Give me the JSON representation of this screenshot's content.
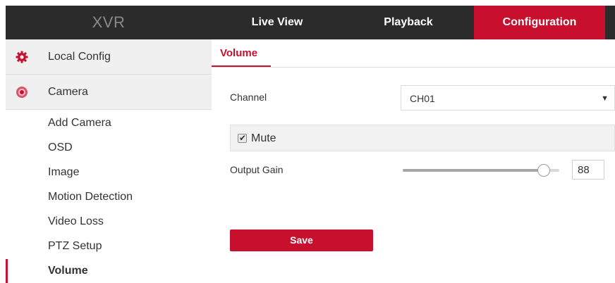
{
  "header": {
    "brand": "XVR",
    "tabs": [
      {
        "label": "Live View",
        "active": false
      },
      {
        "label": "Playback",
        "active": false
      },
      {
        "label": "Configuration",
        "active": true
      }
    ]
  },
  "sidebar": {
    "groups": [
      {
        "label": "Local Config",
        "icon": "gear-icon"
      },
      {
        "label": "Camera",
        "icon": "camera-icon"
      }
    ],
    "items": [
      {
        "label": "Add Camera"
      },
      {
        "label": "OSD"
      },
      {
        "label": "Image"
      },
      {
        "label": "Motion Detection"
      },
      {
        "label": "Video Loss"
      },
      {
        "label": "PTZ Setup"
      },
      {
        "label": "Volume",
        "active": true
      }
    ]
  },
  "main": {
    "tab": "Volume",
    "channel": {
      "label": "Channel",
      "value": "CH01",
      "caret": "▼"
    },
    "mute": {
      "label": "Mute",
      "checked": true
    },
    "output_gain": {
      "label": "Output Gain",
      "value": "88",
      "level_fraction": 0.9
    },
    "save_label": "Save"
  },
  "colors": {
    "accent": "#c8102e",
    "topbar": "#2b2b2b",
    "group_bg": "#f0f0f0"
  }
}
